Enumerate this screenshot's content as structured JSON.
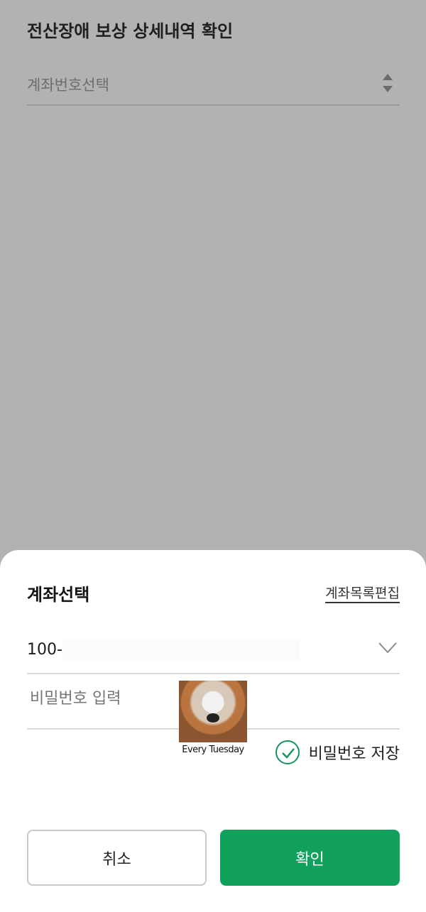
{
  "background": {
    "title": "전산장애 보상 상세내역 확인",
    "account_select_placeholder": "계좌번호선택"
  },
  "sheet": {
    "title": "계좌선택",
    "edit_link": "계좌목록편집",
    "account_number": "100-",
    "password_placeholder": "비밀번호 입력",
    "save_password_label": "비밀번호 저장",
    "save_password_checked": true,
    "cancel_label": "취소",
    "confirm_label": "확인"
  },
  "sticker": {
    "caption": "Every Tuesday"
  },
  "colors": {
    "accent": "#12a05d",
    "overlay": "#b2b2b2"
  },
  "icons": {
    "select_arrows": "updown-arrows-icon",
    "account_dropdown": "chevron-down-icon",
    "save_password": "check-circle-icon"
  }
}
